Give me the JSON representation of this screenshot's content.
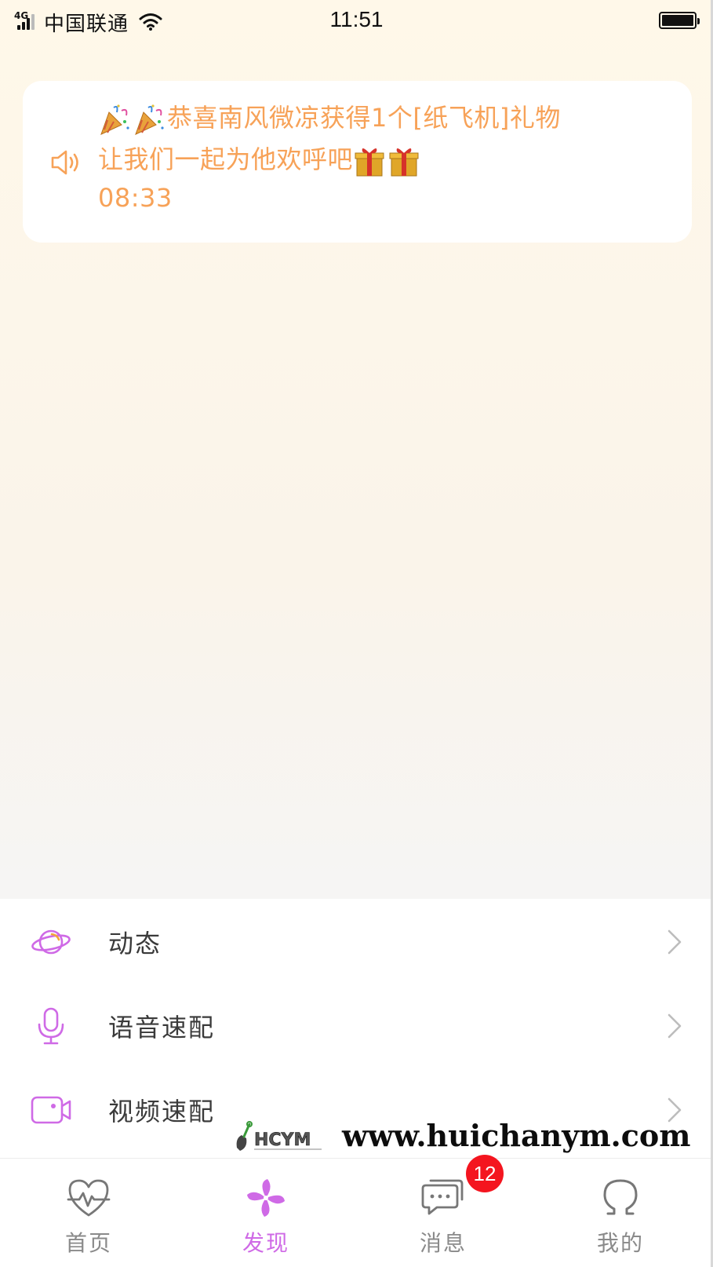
{
  "status_bar": {
    "network": "4G",
    "carrier": "中国联通",
    "time": "11:51"
  },
  "notice": {
    "line1": "恭喜南风微凉获得1个[纸飞机]礼物",
    "line2": "让我们一起为他欢呼吧",
    "time": "08:33",
    "text_color": "#f7a258"
  },
  "menu": {
    "items": [
      {
        "label": "动态",
        "icon": "planet-icon"
      },
      {
        "label": "语音速配",
        "icon": "microphone-icon"
      },
      {
        "label": "视频速配",
        "icon": "video-camera-icon"
      }
    ],
    "icon_color": "#cf6ae6"
  },
  "watermark": {
    "logo": "HCYM",
    "url": "www.huichanym.com"
  },
  "tabs": [
    {
      "label": "首页",
      "icon": "heartbeat-icon",
      "active": false
    },
    {
      "label": "发现",
      "icon": "pinwheel-icon",
      "active": true
    },
    {
      "label": "消息",
      "icon": "chat-bubble-icon",
      "active": false,
      "badge": "12"
    },
    {
      "label": "我的",
      "icon": "profile-omega-icon",
      "active": false
    }
  ],
  "accent_color": "#cf6ae6",
  "badge_color": "#f4151f"
}
